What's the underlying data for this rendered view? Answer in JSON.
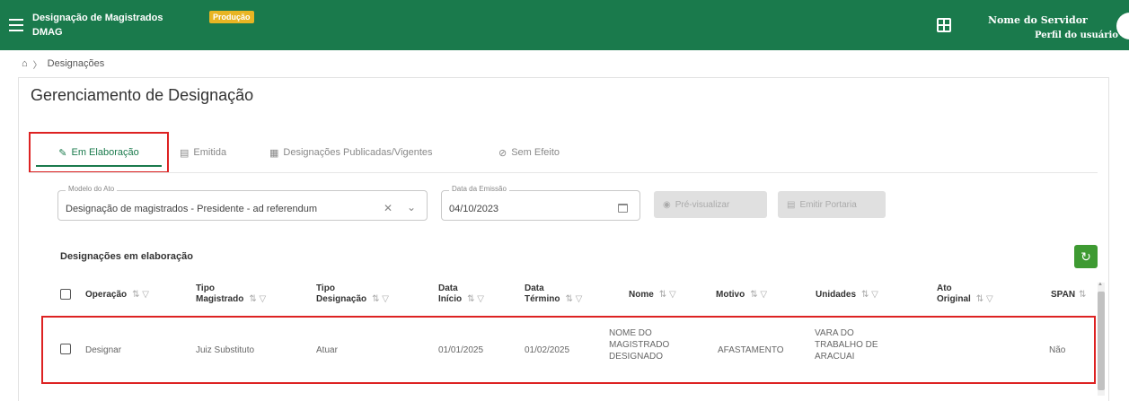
{
  "header": {
    "app_title": "Designação de Magistrados",
    "app_subtitle": "DMAG",
    "env_badge": "Produção",
    "user_name": "Nome do Servidor",
    "user_profile": "Perfil do usuário",
    "brand_color": "#1a7a4c",
    "badge_color": "#e8b523"
  },
  "breadcrumb": {
    "home_icon": "home-icon",
    "current": "Designações"
  },
  "page": {
    "title": "Gerenciamento de Designação"
  },
  "tabs": [
    {
      "label": "Em Elaboração",
      "icon": "edit-user-icon",
      "active": true
    },
    {
      "label": "Emitida",
      "icon": "document-icon",
      "active": false
    },
    {
      "label": "Designações Publicadas/Vigentes",
      "icon": "calendar-icon",
      "active": false
    },
    {
      "label": "Sem Efeito",
      "icon": "cancel-circle-icon",
      "active": false
    }
  ],
  "form": {
    "modelo_label": "Modelo do Ato",
    "modelo_value": "Designação de magistrados - Presidente - ad referendum",
    "data_label": "Data da Emissão",
    "data_value": "04/10/2023",
    "preview_button": "Pré-visualizar",
    "emit_button": "Emitir Portaria"
  },
  "table": {
    "title": "Designações em elaboração",
    "columns": [
      {
        "line1": "Operação",
        "line2": ""
      },
      {
        "line1": "Tipo",
        "line2": "Magistrado"
      },
      {
        "line1": "Tipo",
        "line2": "Designação"
      },
      {
        "line1": "Data",
        "line2": "Início"
      },
      {
        "line1": "Data",
        "line2": "Término"
      },
      {
        "line1": "Nome",
        "line2": ""
      },
      {
        "line1": "Motivo",
        "line2": ""
      },
      {
        "line1": "Unidades",
        "line2": ""
      },
      {
        "line1": "Ato",
        "line2": "Original"
      },
      {
        "line1": "SPAN",
        "line2": ""
      }
    ],
    "sort_glyph": "⇅",
    "filter_glyph": "▽",
    "rows": [
      {
        "operacao": "Designar",
        "tipo_magistrado": "Juiz Substituto",
        "tipo_designacao": "Atuar",
        "data_inicio": "01/01/2025",
        "data_termino": "01/02/2025",
        "nome": "NOME DO MAGISTRADO DESIGNADO",
        "motivo": "AFASTAMENTO",
        "unidades": "VARA DO TRABALHO DE ARACUAI",
        "ato_original": "",
        "span": "Não"
      }
    ]
  }
}
